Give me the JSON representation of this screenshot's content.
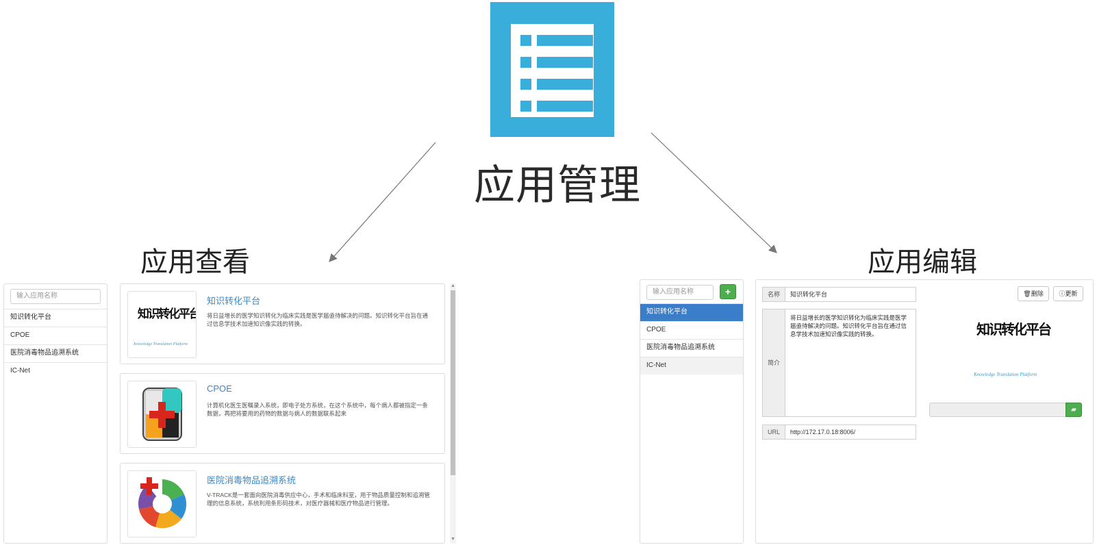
{
  "header": {
    "main_title": "应用管理",
    "view_title": "应用查看",
    "edit_title": "应用编辑",
    "icon": "list-icon"
  },
  "colors": {
    "accent_blue": "#3aaedb",
    "active_item": "#3a7dc9",
    "link_blue": "#3a88c8",
    "green_button": "#4cae4c"
  },
  "view_panel": {
    "search_placeholder": "输入应用名称",
    "items": [
      {
        "label": "知识转化平台"
      },
      {
        "label": "CPOE"
      },
      {
        "label": "医院消毒物品追溯系统"
      },
      {
        "label": "IC-Net"
      }
    ],
    "cards": [
      {
        "title": "知识转化平台",
        "description": "将日益增长的医学知识转化为临床实践是医学届亟待解决的问题。知识转化平台旨在通过信息学技术加速知识像实践的转换。",
        "logo_cn": "知识转化平台",
        "logo_en": "Knowledge Translation Platform"
      },
      {
        "title": "CPOE",
        "description": "计算机化医生医嘱录入系统，即电子处方系统，在这个系统中，每个病人都被指定一条数据，再把将要用的药物的数据与病人的数据联系起来"
      },
      {
        "title": "医院消毒物品追溯系统",
        "description": "V-TRACK是一套面向医院消毒供应中心，手术和临床科室，用于物品质量控制和追溯管理的信息系统，系统利用条形码技术，对医疗器械和医疗物品进行管理。"
      }
    ]
  },
  "edit_panel": {
    "search_placeholder": "输入应用名称",
    "add_icon": "plus-icon",
    "items": [
      {
        "label": "知识转化平台",
        "state": "active"
      },
      {
        "label": "CPOE",
        "state": "normal"
      },
      {
        "label": "医院消毒物品追溯系统",
        "state": "normal"
      },
      {
        "label": "IC-Net",
        "state": "hover"
      }
    ],
    "form": {
      "name_label": "名称",
      "name_value": "知识转化平台",
      "intro_label": "简介",
      "intro_value": "将日益增长的医学知识转化为临床实践是医学届亟待解决的问题。知识转化平台旨在通过信息学技术加速知识像实践的转换。",
      "url_label": "URL",
      "url_value": "http://172.17.0.18:8006/",
      "delete_label": "删除",
      "update_label": "更新",
      "delete_icon": "trash-icon",
      "update_icon": "info-circle-icon",
      "folder_icon": "folder-open-icon",
      "logo_cn": "知识转化平台",
      "logo_en": "Knowledge Translation Platform"
    }
  }
}
